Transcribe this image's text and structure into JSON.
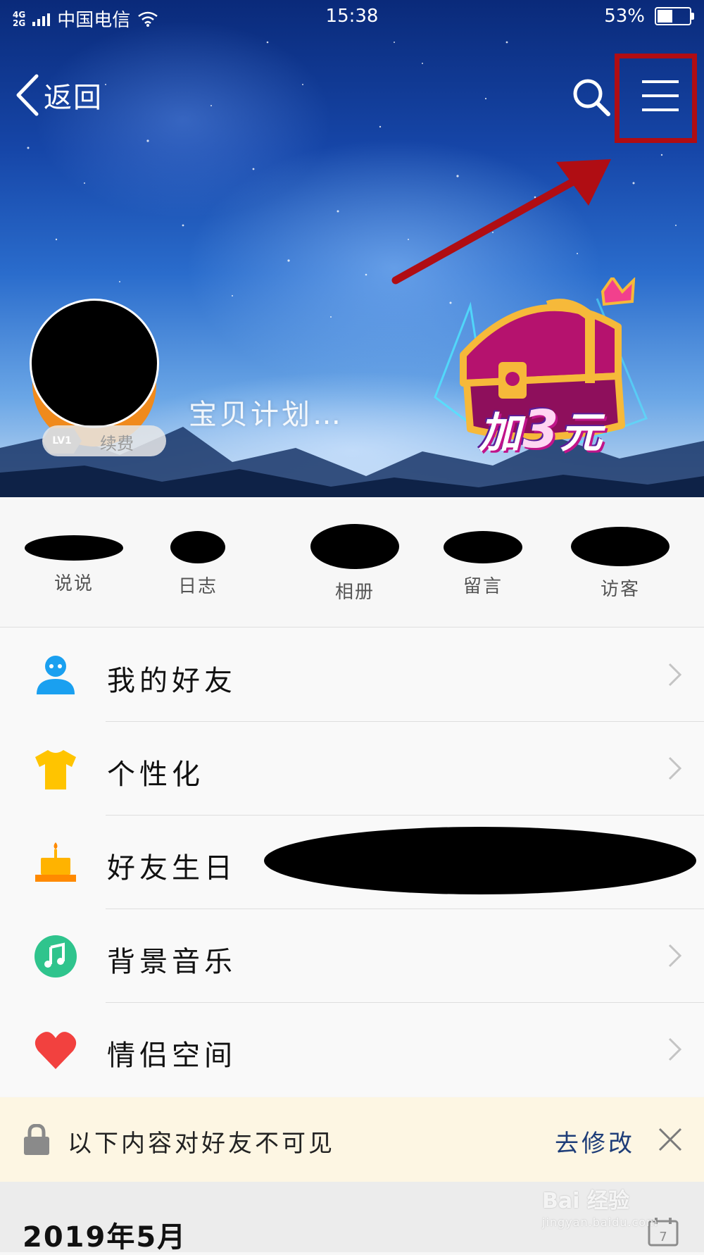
{
  "status_bar": {
    "network_top": "4G",
    "network_bottom": "2G",
    "carrier": "中国电信",
    "time": "15:38",
    "battery": "53%",
    "battery_level": 0.53,
    "icons": [
      "signal-icon",
      "wifi-icon",
      "battery-icon"
    ]
  },
  "header": {
    "back_label": "返回",
    "icons": [
      "back-chevron-icon",
      "search-icon",
      "menu-icon"
    ],
    "highlight_color": "#b00d13"
  },
  "profile": {
    "level_badge": "LV1",
    "renew_label": "续费",
    "nickname": "宝贝计划…"
  },
  "promo": {
    "prefix": "加",
    "amount": "3",
    "suffix": "元",
    "icon": "treasure-chest-icon"
  },
  "stats": [
    {
      "label": "说说"
    },
    {
      "label": "日志"
    },
    {
      "label": "相册"
    },
    {
      "label": "留言"
    },
    {
      "label": "访客"
    }
  ],
  "menu": [
    {
      "label": "我的好友",
      "icon": "friend-icon",
      "color": "#1aa0f0"
    },
    {
      "label": "个性化",
      "icon": "tshirt-icon",
      "color": "#ffc400"
    },
    {
      "label": "好友生日",
      "icon": "birthday-cake-icon",
      "color": "#ffb300"
    },
    {
      "label": "背景音乐",
      "icon": "music-note-icon",
      "color": "#2fc48d"
    },
    {
      "label": "情侣空间",
      "icon": "heart-icon",
      "color": "#f2413f"
    }
  ],
  "privacy_notice": {
    "message": "以下内容对好友不可见",
    "action": "去修改",
    "icons": [
      "lock-icon",
      "close-icon"
    ]
  },
  "timeline": {
    "date": "2019年5月",
    "calendar_day": "7"
  },
  "watermark": {
    "brand": "Bai 经验",
    "url": "jingyan.baidu.com"
  }
}
